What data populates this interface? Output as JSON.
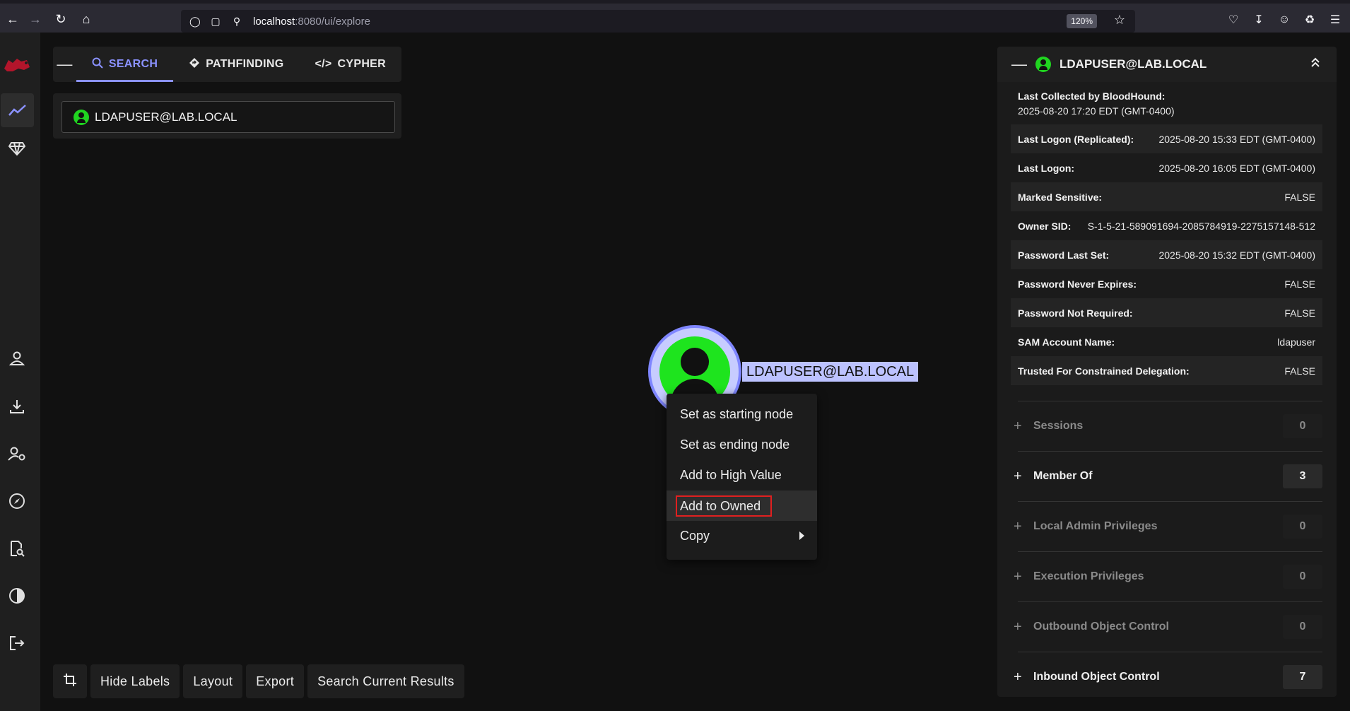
{
  "browser": {
    "url_host": "localhost",
    "url_path": ":8080/ui/explore",
    "zoom": "120%"
  },
  "tabs": [
    {
      "label": "SEARCH",
      "icon": "search-icon"
    },
    {
      "label": "PATHFINDING",
      "icon": "diamond-route-icon"
    },
    {
      "label": "CYPHER",
      "icon": "code-icon"
    }
  ],
  "search": {
    "value": "LDAPUSER@LAB.LOCAL"
  },
  "graph": {
    "node_label": "LDAPUSER@LAB.LOCAL",
    "node_color": "#1ee41e"
  },
  "context_menu": {
    "items": [
      {
        "label": "Set as starting node"
      },
      {
        "label": "Set as ending node"
      },
      {
        "label": "Add to High Value"
      },
      {
        "label": "Add to Owned"
      },
      {
        "label": "Copy"
      }
    ]
  },
  "bottom_bar": {
    "hide_labels": "Hide Labels",
    "layout": "Layout",
    "export": "Export",
    "search_current": "Search Current Results"
  },
  "panel": {
    "title": "LDAPUSER@LAB.LOCAL",
    "last_collected_label": "Last Collected by BloodHound:",
    "last_collected_value": "2025-08-20 17:20 EDT (GMT-0400)",
    "properties": [
      {
        "key": "Last Logon (Replicated):",
        "value": "2025-08-20 15:33 EDT (GMT-0400)"
      },
      {
        "key": "Last Logon:",
        "value": "2025-08-20 16:05 EDT (GMT-0400)"
      },
      {
        "key": "Marked Sensitive:",
        "value": "FALSE"
      },
      {
        "key": "Owner SID:",
        "value": "S-1-5-21-589091694-2085784919-2275157148-512"
      },
      {
        "key": "Password Last Set:",
        "value": "2025-08-20 15:32 EDT (GMT-0400)"
      },
      {
        "key": "Password Never Expires:",
        "value": "FALSE"
      },
      {
        "key": "Password Not Required:",
        "value": "FALSE"
      },
      {
        "key": "SAM Account Name:",
        "value": "ldapuser"
      },
      {
        "key": "Trusted For Constrained Delegation:",
        "value": "FALSE"
      }
    ],
    "sections": [
      {
        "name": "Sessions",
        "count": "0"
      },
      {
        "name": "Member Of",
        "count": "3"
      },
      {
        "name": "Local Admin Privileges",
        "count": "0"
      },
      {
        "name": "Execution Privileges",
        "count": "0"
      },
      {
        "name": "Outbound Object Control",
        "count": "0"
      },
      {
        "name": "Inbound Object Control",
        "count": "7"
      }
    ]
  },
  "colors": {
    "accent": "#8b92ff",
    "user_node": "#1ee41e",
    "highlight_box": "#e02020"
  }
}
